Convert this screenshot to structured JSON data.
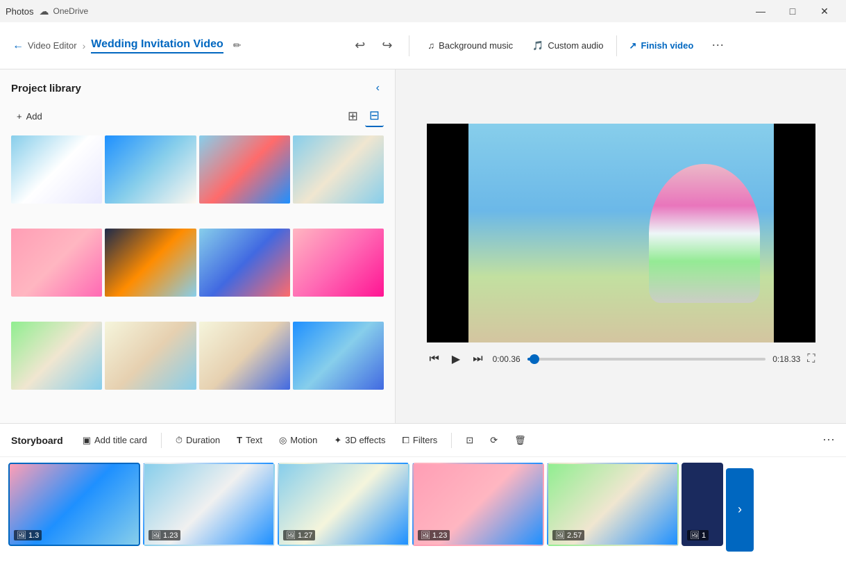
{
  "titlebar": {
    "app": "Photos",
    "onedrive": "OneDrive",
    "minimize": "—",
    "maximize": "□",
    "close": "✕"
  },
  "toolbar": {
    "back_icon": "←",
    "breadcrumb_parent": "Video Editor",
    "breadcrumb_sep": "›",
    "breadcrumb_current": "Wedding Invitation Video",
    "edit_icon": "✏",
    "undo_icon": "↩",
    "redo_icon": "↪",
    "background_music_label": "Background music",
    "custom_audio_label": "Custom audio",
    "finish_video_label": "Finish video",
    "more_icon": "⋯",
    "music_icon": "♫",
    "audio_icon": "🎵",
    "share_icon": "↗"
  },
  "project_library": {
    "title": "Project library",
    "collapse_icon": "‹",
    "add_label": "Add",
    "add_icon": "+",
    "view_large_icon": "⊞",
    "view_small_icon": "⊟",
    "photos": [
      {
        "id": 1,
        "class": "thumb-1"
      },
      {
        "id": 2,
        "class": "thumb-2"
      },
      {
        "id": 3,
        "class": "thumb-3"
      },
      {
        "id": 4,
        "class": "thumb-4"
      },
      {
        "id": 5,
        "class": "thumb-5"
      },
      {
        "id": 6,
        "class": "thumb-6"
      },
      {
        "id": 7,
        "class": "thumb-7"
      },
      {
        "id": 8,
        "class": "thumb-8"
      },
      {
        "id": 9,
        "class": "thumb-9"
      },
      {
        "id": 10,
        "class": "thumb-10"
      },
      {
        "id": 11,
        "class": "thumb-11"
      },
      {
        "id": 12,
        "class": "thumb-12"
      }
    ]
  },
  "video_preview": {
    "time_current": "0:00.36",
    "time_total": "0:18.33",
    "play_icon": "▶",
    "prev_icon": "⏮",
    "next_icon": "⏭",
    "fullscreen_icon": "⛶",
    "progress_percent": 3
  },
  "storyboard": {
    "title": "Storyboard",
    "add_title_card_label": "Add title card",
    "add_title_card_icon": "▣",
    "duration_label": "Duration",
    "duration_icon": "⏱",
    "text_label": "Text",
    "text_icon": "T",
    "motion_label": "Motion",
    "motion_icon": "◎",
    "effects_3d_label": "3D effects",
    "effects_3d_icon": "✦",
    "filters_label": "Filters",
    "filters_icon": "⧠",
    "split_icon": "⊡",
    "speed_icon": "⏩",
    "delete_icon": "🗑",
    "more_icon": "⋯",
    "nav_next_icon": "›",
    "clips": [
      {
        "id": 1,
        "duration": "1.3",
        "class": "clip-bg-1",
        "selected": true
      },
      {
        "id": 2,
        "duration": "1.23",
        "class": "clip-bg-2",
        "selected": false
      },
      {
        "id": 3,
        "duration": "1.27",
        "class": "clip-bg-3",
        "selected": false
      },
      {
        "id": 4,
        "duration": "1.23",
        "class": "clip-bg-4",
        "selected": false
      },
      {
        "id": 5,
        "duration": "2.57",
        "class": "clip-bg-5",
        "selected": false
      },
      {
        "id": 6,
        "duration": "1",
        "class": "clip-bg-6",
        "selected": false
      }
    ]
  }
}
